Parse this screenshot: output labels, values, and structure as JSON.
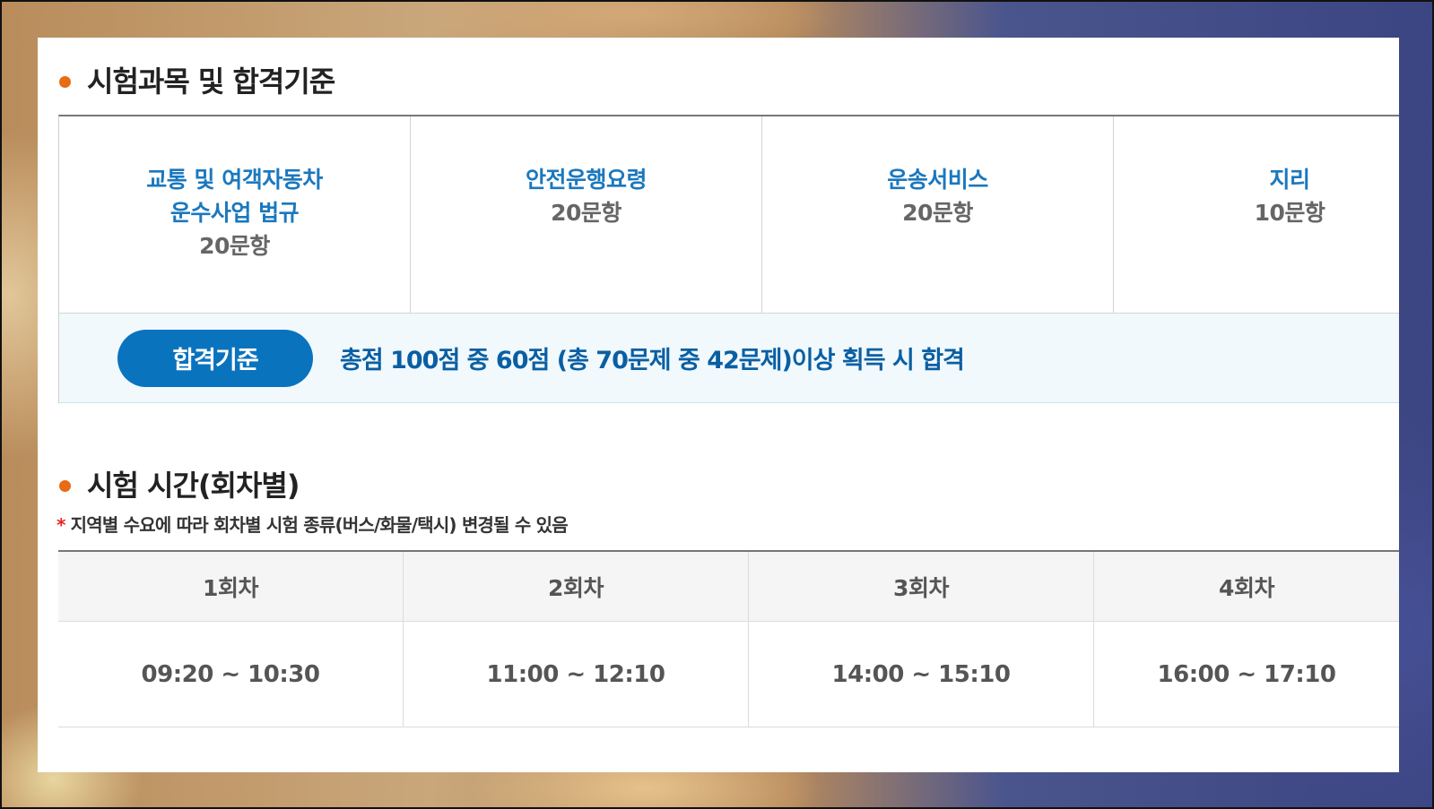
{
  "section1": {
    "title": "시험과목 및 합격기준"
  },
  "subjects": [
    {
      "name_lines": [
        "교통 및 여객자동차",
        "운수사업 법규"
      ],
      "count": "20문항"
    },
    {
      "name_lines": [
        "안전운행요령"
      ],
      "count": "20문항"
    },
    {
      "name_lines": [
        "운송서비스"
      ],
      "count": "20문항"
    },
    {
      "name_lines": [
        "지리"
      ],
      "count": "10문항"
    }
  ],
  "pass": {
    "button_label": "합격기준",
    "text": "총점 100점 중 60점 (총 70문제 중 42문제)이상 획득 시 합격"
  },
  "section2": {
    "title": "시험 시간(회차별)"
  },
  "note": {
    "marker": "*",
    "text": "지역별 수요에 따라 회차별 시험 종류(버스/화물/택시) 변경될 수 있음"
  },
  "times": {
    "headers": [
      "1회차",
      "2회차",
      "3회차",
      "4회차"
    ],
    "values": [
      "09:20 ~ 10:30",
      "11:00 ~ 12:10",
      "14:00 ~ 15:10",
      "16:00 ~ 17:10"
    ]
  },
  "colors": {
    "accent_dot": "#e86b15",
    "subject_blue": "#1b78be",
    "pass_button": "#0a73be",
    "pass_text": "#0a5fa3",
    "note_star": "#ee2222"
  }
}
